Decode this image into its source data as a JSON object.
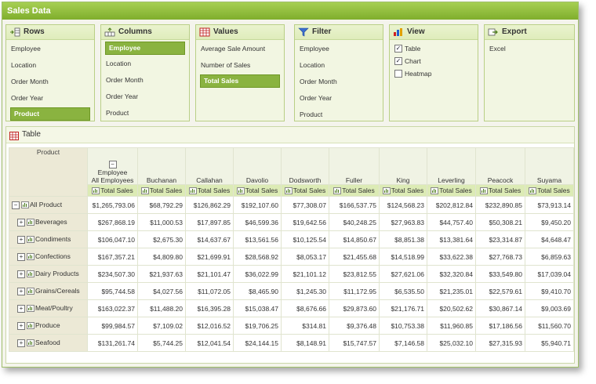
{
  "window": {
    "title": "Sales Data"
  },
  "panels": {
    "rows": {
      "title": "Rows",
      "items": [
        "Employee",
        "Location",
        "Order Month",
        "Order Year",
        "Product"
      ],
      "selected": "Product"
    },
    "columns": {
      "title": "Columns",
      "items": [
        "Employee",
        "Location",
        "Order Month",
        "Order Year",
        "Product"
      ],
      "selected": "Employee"
    },
    "values": {
      "title": "Values",
      "items": [
        "Average Sale Amount",
        "Number of Sales",
        "Total Sales"
      ],
      "selected": "Total Sales"
    },
    "filter": {
      "title": "Filter",
      "items": [
        "Employee",
        "Location",
        "Order Month",
        "Order Year",
        "Product"
      ]
    },
    "view": {
      "title": "View",
      "options": [
        {
          "label": "Table",
          "checked": true
        },
        {
          "label": "Chart",
          "checked": true
        },
        {
          "label": "Heatmap",
          "checked": false
        }
      ]
    },
    "export": {
      "title": "Export",
      "items": [
        "Excel"
      ]
    }
  },
  "table": {
    "title": "Table",
    "corner_label": "Product",
    "all_header": {
      "line1": "Employee",
      "line2": "All Employees"
    },
    "columns": [
      "Buchanan",
      "Callahan",
      "Davolio",
      "Dodsworth",
      "Fuller",
      "King",
      "Leverling",
      "Peacock",
      "Suyama"
    ],
    "measure_label": "Total Sales",
    "rows": [
      {
        "label": "All Product",
        "values": [
          "$1,265,793.06",
          "$68,792.29",
          "$126,862.29",
          "$192,107.60",
          "$77,308.07",
          "$166,537.75",
          "$124,568.23",
          "$202,812.84",
          "$232,890.85",
          "$73,913.14"
        ]
      },
      {
        "label": "Beverages",
        "values": [
          "$267,868.19",
          "$11,000.53",
          "$17,897.85",
          "$46,599.36",
          "$19,642.56",
          "$40,248.25",
          "$27,963.83",
          "$44,757.40",
          "$50,308.21",
          "$9,450.20"
        ]
      },
      {
        "label": "Condiments",
        "values": [
          "$106,047.10",
          "$2,675.30",
          "$14,637.67",
          "$13,561.56",
          "$10,125.54",
          "$14,850.67",
          "$8,851.38",
          "$13,381.64",
          "$23,314.87",
          "$4,648.47"
        ]
      },
      {
        "label": "Confections",
        "values": [
          "$167,357.21",
          "$4,809.80",
          "$21,699.91",
          "$28,568.92",
          "$8,053.17",
          "$21,455.68",
          "$14,518.99",
          "$33,622.38",
          "$27,768.73",
          "$6,859.63"
        ]
      },
      {
        "label": "Dairy Products",
        "values": [
          "$234,507.30",
          "$21,937.63",
          "$21,101.47",
          "$36,022.99",
          "$21,101.12",
          "$23,812.55",
          "$27,621.06",
          "$32,320.84",
          "$33,549.80",
          "$17,039.04"
        ]
      },
      {
        "label": "Grains/Cereals",
        "values": [
          "$95,744.58",
          "$4,027.56",
          "$11,072.05",
          "$8,465.90",
          "$1,245.30",
          "$11,172.95",
          "$6,535.50",
          "$21,235.01",
          "$22,579.61",
          "$9,410.70"
        ]
      },
      {
        "label": "Meat/Poultry",
        "values": [
          "$163,022.37",
          "$11,488.20",
          "$16,395.28",
          "$15,038.47",
          "$8,676.66",
          "$29,873.60",
          "$21,176.71",
          "$20,502.62",
          "$30,867.14",
          "$9,003.69"
        ]
      },
      {
        "label": "Produce",
        "values": [
          "$99,984.57",
          "$7,109.02",
          "$12,016.52",
          "$19,706.25",
          "$314.81",
          "$9,376.48",
          "$10,753.38",
          "$11,960.85",
          "$17,186.56",
          "$11,560.70"
        ]
      },
      {
        "label": "Seafood",
        "values": [
          "$131,261.74",
          "$5,744.25",
          "$12,041.54",
          "$24,144.15",
          "$8,148.91",
          "$15,747.57",
          "$7,146.58",
          "$25,032.10",
          "$27,315.93",
          "$5,940.71"
        ]
      }
    ]
  },
  "colors": {
    "accent": "#8ab340",
    "header": "#7fae2c"
  }
}
